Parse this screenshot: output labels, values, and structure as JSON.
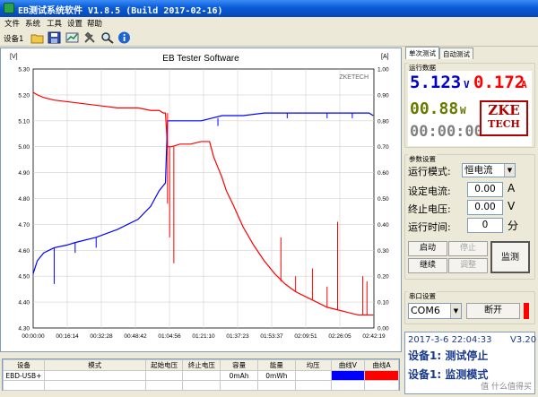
{
  "window": {
    "title": "EB测试系统软件 V1.8.5 (Build 2017-02-16)"
  },
  "menu": [
    "文件",
    "系统",
    "工具",
    "设置",
    "帮助"
  ],
  "toolbar": {
    "device": "设备1"
  },
  "colors": {
    "voltage": "#0000ff",
    "current": "#ff0000",
    "lcd_blue": "#0000cc",
    "lcd_red": "#ff0000",
    "lcd_green": "#6a7a00",
    "lcd_gray": "#808080"
  },
  "chart": {
    "title": "EB Tester Software",
    "watermark": "ZKETECH",
    "left_unit": "[V]",
    "right_unit": "[A]",
    "left_ticks": [
      "5.30",
      "5.20",
      "5.10",
      "5.00",
      "4.90",
      "4.80",
      "4.70",
      "4.60",
      "4.50",
      "4.40",
      "4.30"
    ],
    "right_ticks": [
      "1.00",
      "0.90",
      "0.80",
      "0.70",
      "0.60",
      "0.50",
      "0.40",
      "0.30",
      "0.20",
      "0.10",
      "0.00"
    ],
    "x_ticks": [
      "00:00:00",
      "00:16:14",
      "00:32:28",
      "00:48:42",
      "01:04:56",
      "01:21:10",
      "01:37:23",
      "01:53:37",
      "02:09:51",
      "02:26:05",
      "02:42:19"
    ]
  },
  "chart_data": {
    "type": "line",
    "x_unit": "minutes",
    "xlim": [
      0,
      162.3
    ],
    "y_left_label": "[V]",
    "ylim_left": [
      4.3,
      5.3
    ],
    "y_right_label": "[A]",
    "ylim_right": [
      0,
      1.0
    ],
    "grid": true,
    "series": [
      {
        "name": "曲线V",
        "axis": "left",
        "x": [
          0,
          2,
          5,
          10,
          16,
          20,
          30,
          40,
          50,
          56,
          58,
          60,
          62,
          63,
          64,
          65,
          66,
          68,
          70,
          75,
          80,
          85,
          90,
          95,
          100,
          110,
          120,
          130,
          140,
          150,
          155,
          160,
          162
        ],
        "y": [
          4.51,
          4.56,
          4.59,
          4.61,
          4.62,
          4.63,
          4.65,
          4.68,
          4.72,
          4.77,
          4.8,
          4.83,
          4.85,
          4.86,
          5.1,
          5.1,
          5.1,
          5.1,
          5.1,
          5.1,
          5.1,
          5.11,
          5.12,
          5.12,
          5.12,
          5.13,
          5.13,
          5.13,
          5.13,
          5.13,
          5.13,
          5.13,
          5.12
        ]
      },
      {
        "name": "曲线A",
        "axis": "right",
        "x": [
          0,
          2,
          5,
          10,
          20,
          30,
          40,
          50,
          56,
          58,
          60,
          62,
          63,
          64,
          66,
          70,
          75,
          80,
          84,
          85,
          86,
          88,
          90,
          92,
          95,
          100,
          105,
          110,
          115,
          120,
          125,
          130,
          135,
          140,
          145,
          150,
          155,
          160,
          162
        ],
        "y": [
          0.91,
          0.9,
          0.89,
          0.88,
          0.87,
          0.86,
          0.85,
          0.85,
          0.84,
          0.84,
          0.84,
          0.83,
          0.83,
          0.7,
          0.7,
          0.71,
          0.71,
          0.72,
          0.72,
          0.69,
          0.66,
          0.62,
          0.58,
          0.53,
          0.48,
          0.39,
          0.32,
          0.26,
          0.21,
          0.17,
          0.14,
          0.12,
          0.1,
          0.08,
          0.07,
          0.06,
          0.05,
          0.05,
          0.05
        ]
      }
    ]
  },
  "table": {
    "headers": [
      "设备",
      "模式",
      "起始电压",
      "终止电压",
      "容量",
      "能量",
      "均压",
      "曲线V",
      "曲线A"
    ],
    "row": [
      "EBD-USB+",
      "",
      "",
      "",
      "0mAh",
      "0mWh",
      "",
      "",
      ""
    ]
  },
  "tabs": [
    "单次测试",
    "自动测试"
  ],
  "readings": {
    "label": "运行数据",
    "voltage": "5.123",
    "voltage_unit": "V",
    "current": "0.172",
    "current_unit": "A",
    "power": "00.88",
    "power_unit": "W",
    "time": "00:00:00"
  },
  "logo": {
    "line1": "ZKE",
    "line2": "TECH"
  },
  "params": {
    "label": "参数设置",
    "mode_label": "运行模式:",
    "mode_value": "恒电流",
    "set_current_label": "设定电流:",
    "set_current_value": "0.00",
    "set_current_unit": "A",
    "end_voltage_label": "终止电压:",
    "end_voltage_value": "0.00",
    "end_voltage_unit": "V",
    "run_time_label": "运行时间:",
    "run_time_value": "0",
    "run_time_unit": "分"
  },
  "buttons": {
    "start": "启动",
    "stop": "停止",
    "continue": "继续",
    "adjust": "调整",
    "monitor": "监测"
  },
  "port": {
    "label": "串口设置",
    "value": "COM6",
    "disconnect": "断开"
  },
  "status": {
    "datetime": "2017-3-6 22:04:33",
    "version": "V3.20",
    "line1": "设备1: 测试停止",
    "line2": "设备1: 监测模式"
  },
  "watermark": "值 什么值得买"
}
